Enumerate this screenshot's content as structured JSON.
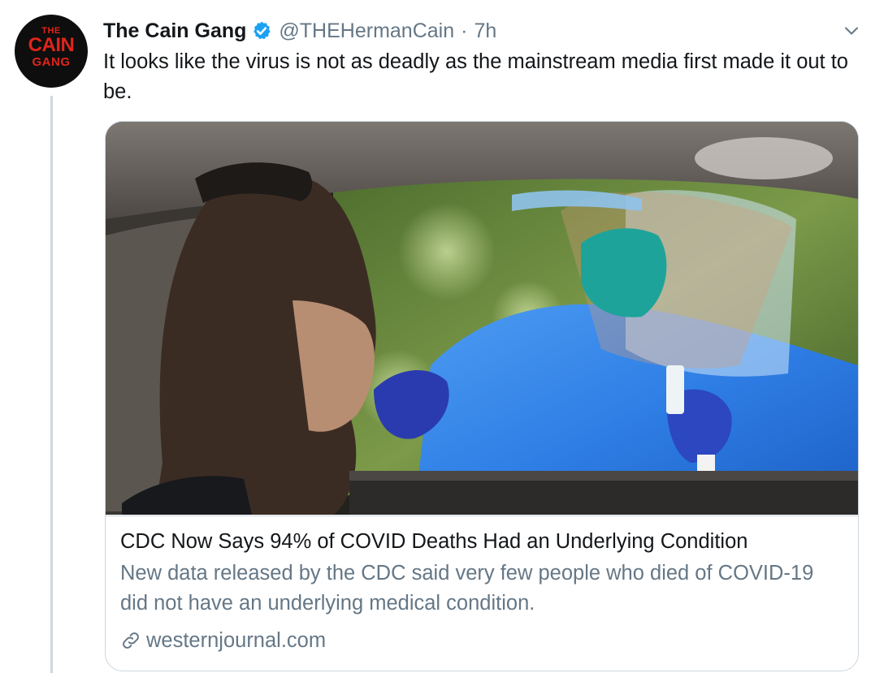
{
  "tweet": {
    "avatar": {
      "line1": "THE",
      "line2": "CAIN",
      "line3": "GANG"
    },
    "display_name": "The Cain Gang",
    "verified": true,
    "handle": "@THEHermanCain",
    "separator": "·",
    "time": "7h",
    "menu_icon": "chevron-down-icon",
    "text": "It looks like the virus is not as deadly as the mainstream media first made it out to be."
  },
  "card": {
    "image_alt": "Man in car being tested by health worker in blue protective gown and face shield",
    "title": "CDC Now Says 94% of COVID Deaths Had an Underlying Condition",
    "description": "New data released by the CDC said very few people who died of COVID-19 did not have an underlying medical condition.",
    "link_icon": "link-icon",
    "domain": "westernjournal.com"
  },
  "colors": {
    "text_primary": "#14171a",
    "text_secondary": "#657786",
    "verified_blue": "#1da1f2",
    "border": "#ccd6dd"
  }
}
